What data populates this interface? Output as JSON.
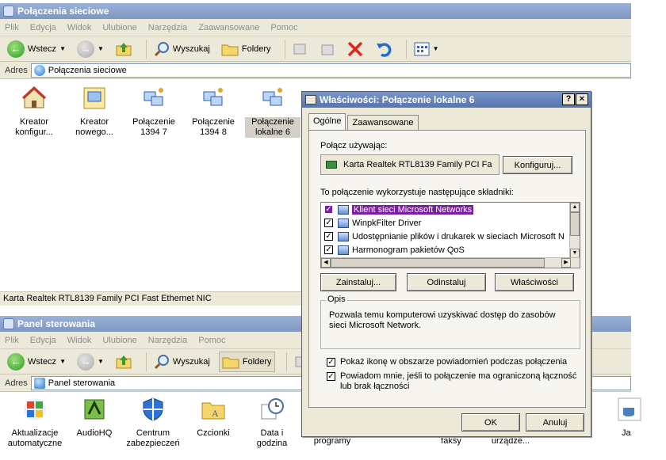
{
  "win1": {
    "title": "Połączenia sieciowe",
    "menu": [
      "Plik",
      "Edycja",
      "Widok",
      "Ulubione",
      "Narzędzia",
      "Zaawansowane",
      "Pomoc"
    ],
    "toolbar": {
      "back": "Wstecz",
      "search": "Wyszukaj",
      "folders": "Foldery"
    },
    "address_label": "Adres",
    "address_value": "Połączenia sieciowe",
    "icons": [
      {
        "label": "Kreator konfigur..."
      },
      {
        "label": "Kreator nowego..."
      },
      {
        "label": "Połączenie 1394 7"
      },
      {
        "label": "Połączenie 1394 8"
      },
      {
        "label": "Połączenie lokalne 6"
      }
    ],
    "status": "Karta Realtek RTL8139 Family PCI Fast Ethernet NIC"
  },
  "win2": {
    "title": "Panel sterowania",
    "menu": [
      "Plik",
      "Edycja",
      "Widok",
      "Ulubione",
      "Narzędzia",
      "Pomoc"
    ],
    "toolbar": {
      "back": "Wstecz",
      "search": "Wyszukaj",
      "folders": "Foldery"
    },
    "address_label": "Adres",
    "address_value": "Panel sterowania",
    "icons": [
      {
        "label": "Aktualizacje automatyczne"
      },
      {
        "label": "AudioHQ"
      },
      {
        "label": "Centrum zabezpieczeń"
      },
      {
        "label": "Czcionki"
      },
      {
        "label": "Data i godzina"
      },
      {
        "label": "programy"
      },
      {
        "label": "faksy"
      },
      {
        "label": "urządze..."
      },
      {
        "label": "Ja"
      }
    ]
  },
  "dialog": {
    "title": "Właściwości: Połączenie lokalne 6",
    "help_btn": "?",
    "close_btn": "×",
    "tabs": [
      "Ogólne",
      "Zaawansowane"
    ],
    "connect_using_label": "Połącz używając:",
    "adapter": "Karta Realtek RTL8139 Family PCI Fa",
    "configure_btn": "Konfiguruj...",
    "components_label": "To połączenie wykorzystuje następujące składniki:",
    "components": [
      {
        "label": "Klient sieci Microsoft Networks"
      },
      {
        "label": "WinpkFilter Driver"
      },
      {
        "label": "Udostępnianie plików i drukarek w sieciach Microsoft N"
      },
      {
        "label": "Harmonogram pakietów QoS"
      }
    ],
    "install_btn": "Zainstaluj...",
    "uninstall_btn": "Odinstaluj",
    "properties_btn": "Właściwości",
    "desc_title": "Opis",
    "desc_text": "Pozwala temu komputerowi uzyskiwać dostęp do zasobów sieci Microsoft Network.",
    "show_icon_label": "Pokaż ikonę w obszarze powiadomień podczas połączenia",
    "notify_label": "Powiadom mnie, jeśli to połączenie ma ograniczoną łączność lub brak łączności",
    "ok_btn": "OK",
    "cancel_btn": "Anuluj"
  },
  "colors": {
    "title_gradient": "#7d97c3",
    "highlight": "#7b1fa2",
    "dialog_bg": "#ece9d8"
  }
}
